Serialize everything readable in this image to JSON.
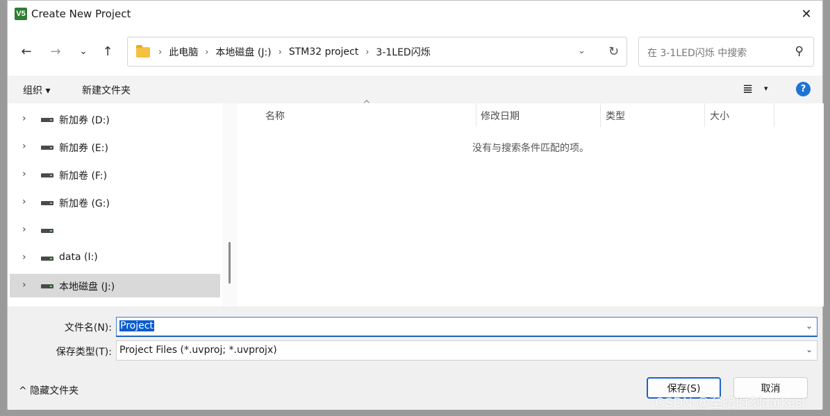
{
  "window": {
    "title": "Create New Project",
    "app_icon_text": "V5",
    "close_glyph": "✕"
  },
  "nav": {
    "back": "←",
    "forward": "→",
    "recent": "⌄",
    "up": "↑"
  },
  "address": {
    "crumbs": [
      "此电脑",
      "本地磁盘 (J:)",
      "STM32 project",
      "3-1LED闪烁"
    ],
    "separator": "›",
    "dropdown": "⌄",
    "refresh": "↻"
  },
  "search": {
    "placeholder": "在 3-1LED闪烁 中搜索",
    "icon": "⚲"
  },
  "commandbar": {
    "organize": "组织 ▾",
    "new_folder": "新建文件夹",
    "view_icon": "≣",
    "view_dd": "▾",
    "help": "?"
  },
  "tree": {
    "chevron": "›",
    "items": [
      {
        "label": "新加券 (D:)"
      },
      {
        "label": "新加券 (E:)"
      },
      {
        "label": "新加卷 (F:)"
      },
      {
        "label": "新加卷 (G:)"
      },
      {
        "label": ""
      },
      {
        "label": "data (I:)"
      },
      {
        "label": "本地磁盘 (J:)"
      }
    ]
  },
  "filelist": {
    "columns": [
      "名称",
      "修改日期",
      "类型",
      "大小"
    ],
    "sort_arrow": "^",
    "empty_message": "没有与搜索条件匹配的项。"
  },
  "bottom": {
    "filename_label": "文件名(N):",
    "filename_value": "Project",
    "type_label": "保存类型(T):",
    "type_value": "Project Files (*.uvproj; *.uvprojx)",
    "chevron": "⌄",
    "hide_folders": "^  隐藏文件夹",
    "save": "保存(S)",
    "cancel": "取消"
  },
  "watermark": "CSDN @至暗时刻darkest"
}
